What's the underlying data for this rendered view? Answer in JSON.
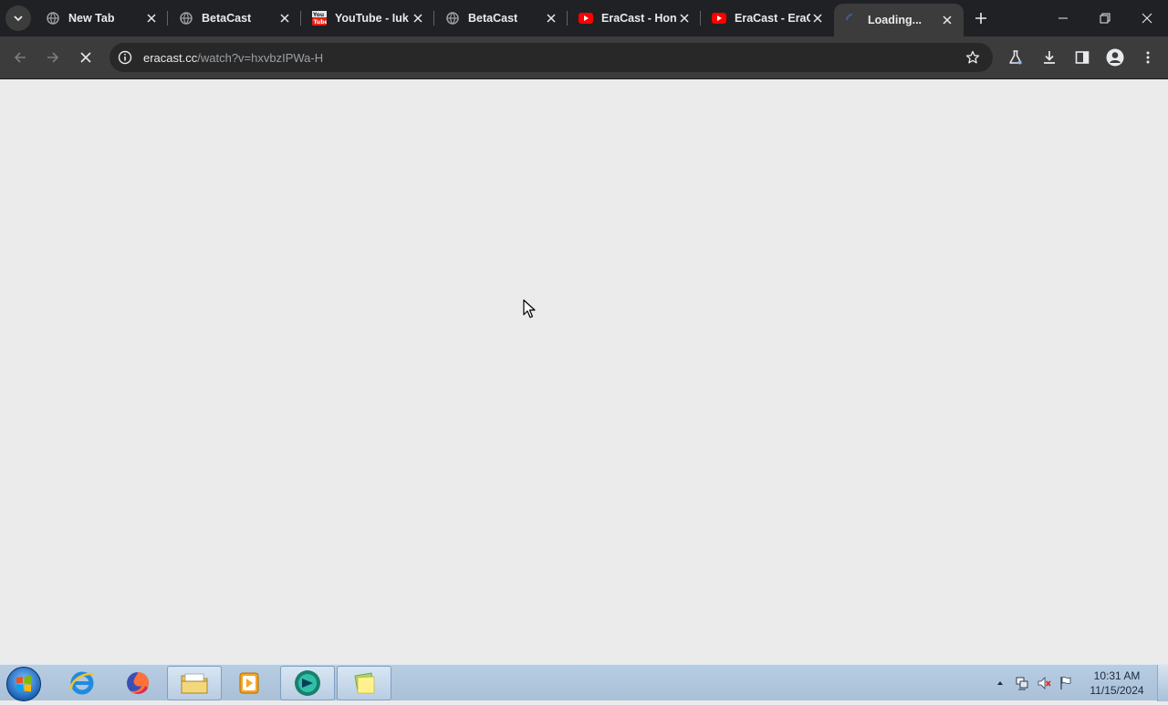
{
  "tabs": [
    {
      "title": "New Tab",
      "favicon": "globe-icon"
    },
    {
      "title": "BetaCast",
      "favicon": "globe-icon"
    },
    {
      "title": "YouTube - Iuk",
      "favicon": "youtube-classic-icon"
    },
    {
      "title": "BetaCast",
      "favicon": "globe-icon"
    },
    {
      "title": "EraCast - Hon",
      "favicon": "youtube-play-icon"
    },
    {
      "title": "EraCast - EraC",
      "favicon": "youtube-play-icon"
    },
    {
      "title": "Loading...",
      "favicon": "loading-icon"
    }
  ],
  "active_tab": 6,
  "address_bar": {
    "host": "eracast.cc",
    "path": "/watch?v=hxvbzIPWa-H"
  },
  "taskbar": {
    "clock_time": "10:31 AM",
    "clock_date": "11/15/2024"
  },
  "colors": {
    "tabstrip_bg": "#202124",
    "toolbar_bg": "#3c3c3c",
    "page_bg": "#ebebeb",
    "youtube_red": "#ff0000"
  }
}
